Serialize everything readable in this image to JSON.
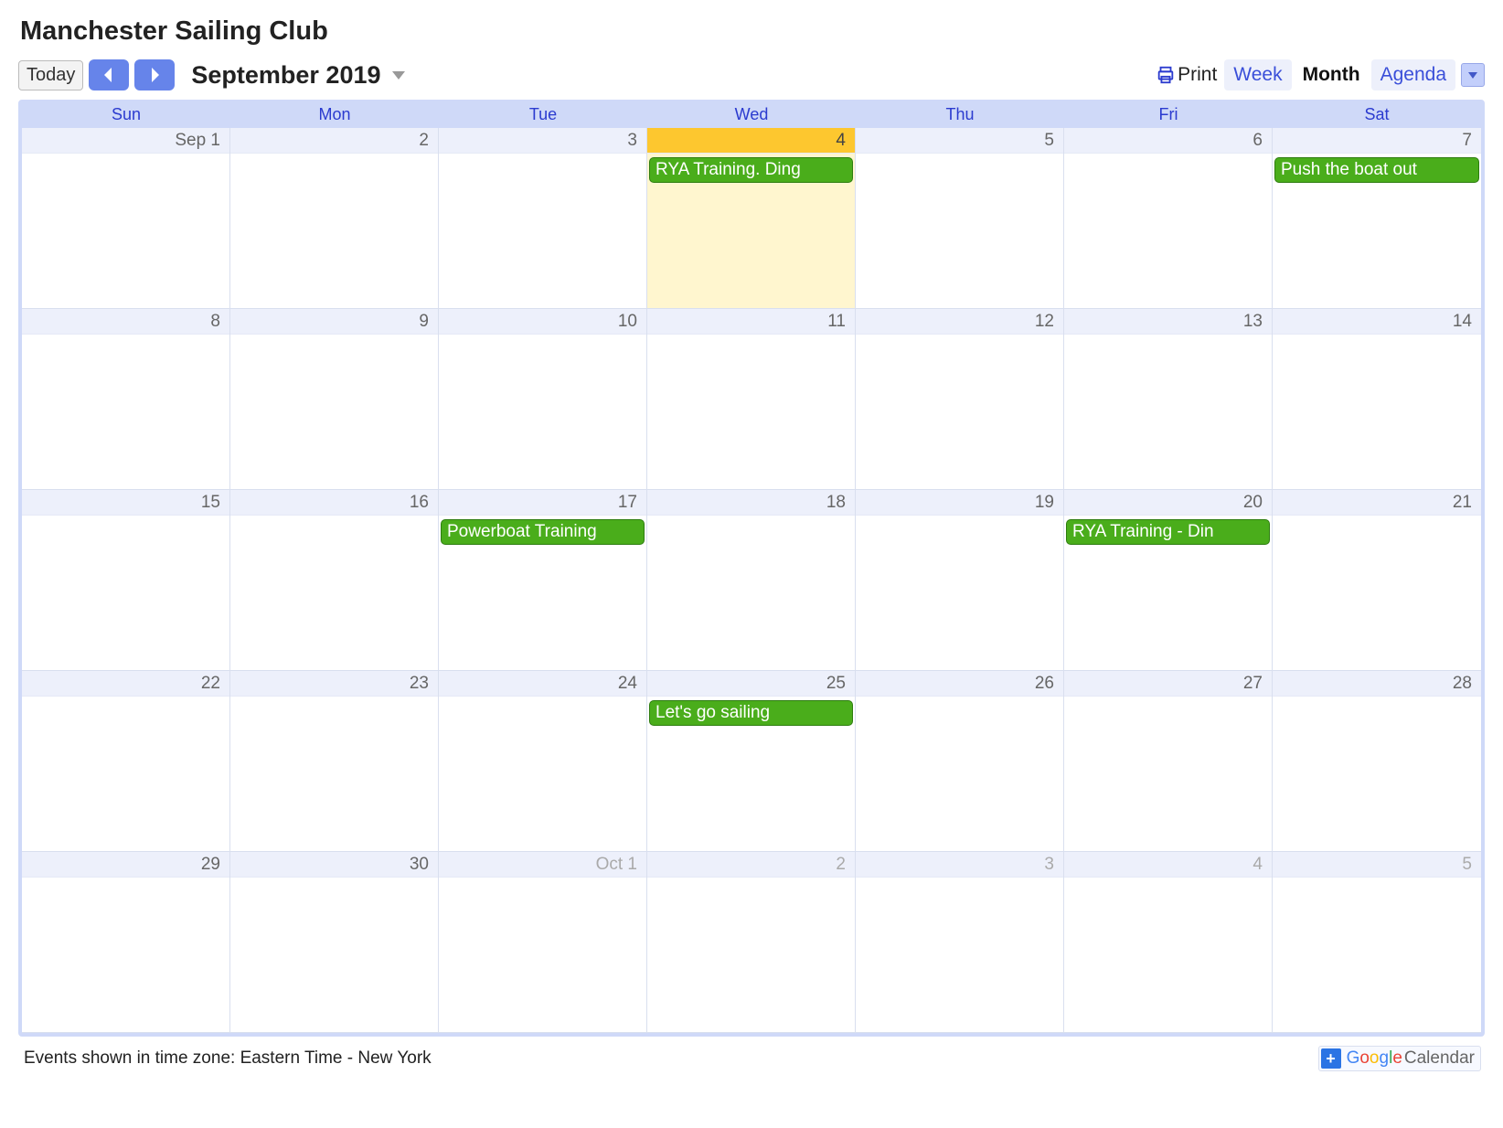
{
  "title": "Manchester Sailing Club",
  "toolbar": {
    "today": "Today",
    "month_label": "September 2019",
    "print": "Print",
    "views": {
      "week": "Week",
      "month": "Month",
      "agenda": "Agenda"
    },
    "active_view": "month"
  },
  "day_headers": [
    "Sun",
    "Mon",
    "Tue",
    "Wed",
    "Thu",
    "Fri",
    "Sat"
  ],
  "weeks": [
    [
      {
        "label": "Sep 1"
      },
      {
        "label": "2"
      },
      {
        "label": "3"
      },
      {
        "label": "4",
        "today": true,
        "events": [
          "RYA Training. Ding"
        ]
      },
      {
        "label": "5"
      },
      {
        "label": "6"
      },
      {
        "label": "7",
        "events": [
          "Push the boat out"
        ]
      }
    ],
    [
      {
        "label": "8"
      },
      {
        "label": "9"
      },
      {
        "label": "10"
      },
      {
        "label": "11"
      },
      {
        "label": "12"
      },
      {
        "label": "13"
      },
      {
        "label": "14"
      }
    ],
    [
      {
        "label": "15"
      },
      {
        "label": "16"
      },
      {
        "label": "17",
        "events": [
          "Powerboat Training"
        ]
      },
      {
        "label": "18"
      },
      {
        "label": "19"
      },
      {
        "label": "20",
        "events": [
          "RYA Training - Din"
        ]
      },
      {
        "label": "21"
      }
    ],
    [
      {
        "label": "22"
      },
      {
        "label": "23"
      },
      {
        "label": "24"
      },
      {
        "label": "25",
        "events": [
          "Let's go sailing"
        ]
      },
      {
        "label": "26"
      },
      {
        "label": "27"
      },
      {
        "label": "28"
      }
    ],
    [
      {
        "label": "29"
      },
      {
        "label": "30"
      },
      {
        "label": "Oct 1",
        "other": true
      },
      {
        "label": "2",
        "other": true
      },
      {
        "label": "3",
        "other": true
      },
      {
        "label": "4",
        "other": true
      },
      {
        "label": "5",
        "other": true
      }
    ]
  ],
  "footer": {
    "tz": "Events shown in time zone: Eastern Time - New York",
    "calendar_word": "Calendar"
  }
}
